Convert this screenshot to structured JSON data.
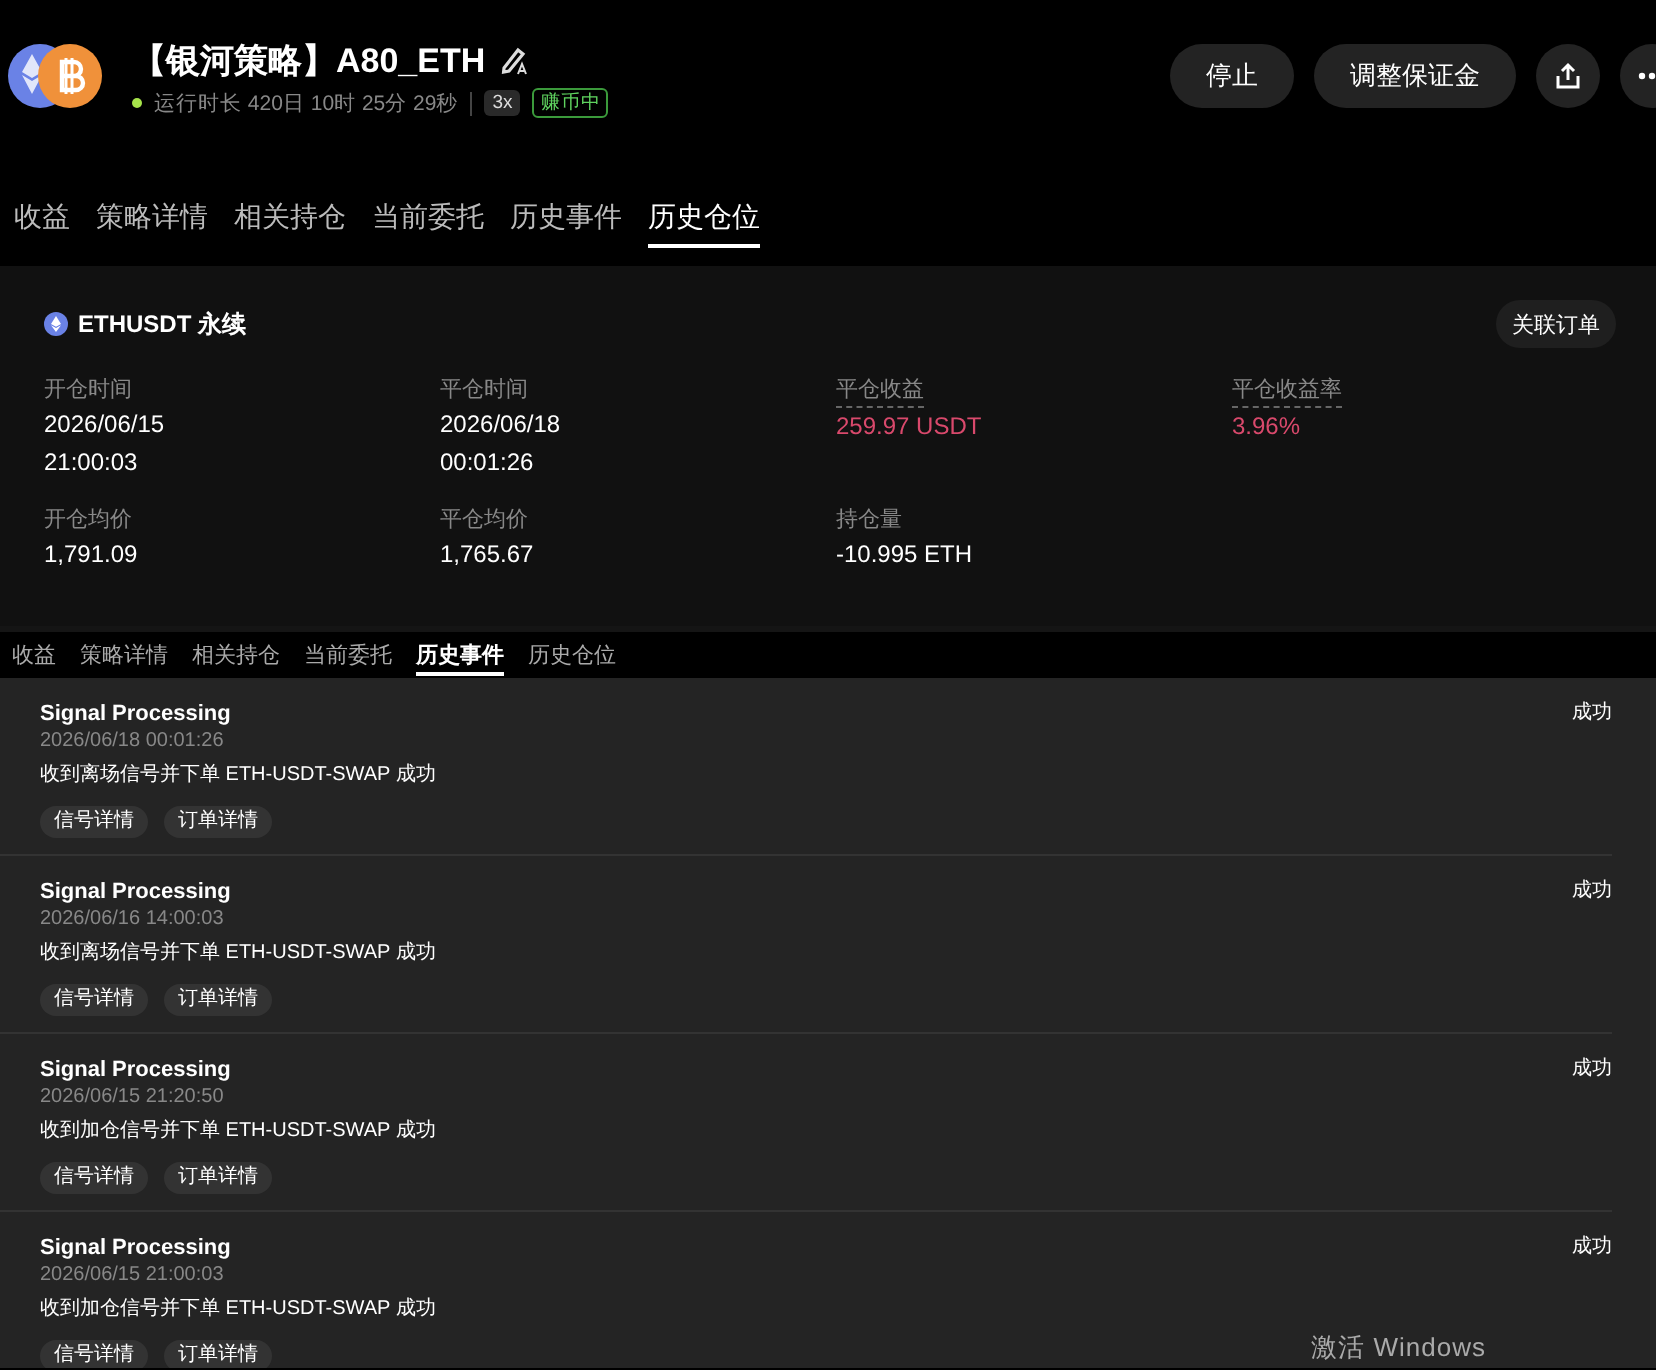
{
  "header": {
    "title": "【银河策略】A80_ETH",
    "runtime": "运行时长 420日 10时 25分 29秒",
    "leverage": "3x",
    "status": "赚币中",
    "running": true,
    "buttons": [
      "停止",
      "调整保证金"
    ]
  },
  "tabs": [
    {
      "label": "收益",
      "selected": false
    },
    {
      "label": "策略详情",
      "selected": false
    },
    {
      "label": "相关持仓",
      "selected": false
    },
    {
      "label": "当前委托",
      "selected": false
    },
    {
      "label": "历史事件",
      "selected": false
    },
    {
      "label": "历史仓位",
      "selected": true
    }
  ],
  "position": {
    "symbol": "ETHUSDT 永续",
    "link_button": "关联订单",
    "fields": [
      {
        "label": "开仓时间",
        "hint": false,
        "highlight": false,
        "values": [
          "2026/06/15",
          "21:00:03"
        ]
      },
      {
        "label": "平仓时间",
        "hint": false,
        "highlight": false,
        "values": [
          "2026/06/18",
          "00:01:26"
        ]
      },
      {
        "label": "平仓收益",
        "hint": true,
        "highlight": true,
        "values": [
          "259.97 USDT"
        ]
      },
      {
        "label": "平仓收益率",
        "hint": true,
        "highlight": true,
        "values": [
          "3.96%"
        ]
      },
      {
        "label": "开仓均价",
        "hint": false,
        "highlight": false,
        "values": [
          "1,791.09"
        ]
      },
      {
        "label": "平仓均价",
        "hint": false,
        "highlight": false,
        "values": [
          "1,765.67"
        ]
      },
      {
        "label": "持仓量",
        "hint": false,
        "highlight": false,
        "values": [
          "-10.995 ETH"
        ]
      }
    ]
  },
  "event_tabs": [
    {
      "label": "收益",
      "selected": false
    },
    {
      "label": "策略详情",
      "selected": false
    },
    {
      "label": "相关持仓",
      "selected": false
    },
    {
      "label": "当前委托",
      "selected": false
    },
    {
      "label": "历史事件",
      "selected": true
    },
    {
      "label": "历史仓位",
      "selected": false
    }
  ],
  "events": [
    {
      "title": "Signal Processing",
      "time": "2026/06/18 00:01:26",
      "message": "收到离场信号并下单 ETH-USDT-SWAP 成功",
      "status": "成功",
      "actions": [
        "信号详情",
        "订单详情"
      ]
    },
    {
      "title": "Signal Processing",
      "time": "2026/06/16 14:00:03",
      "message": "收到离场信号并下单 ETH-USDT-SWAP 成功",
      "status": "成功",
      "actions": [
        "信号详情",
        "订单详情"
      ]
    },
    {
      "title": "Signal Processing",
      "time": "2026/06/15 21:20:50",
      "message": "收到加仓信号并下单 ETH-USDT-SWAP 成功",
      "status": "成功",
      "actions": [
        "信号详情",
        "订单详情"
      ]
    },
    {
      "title": "Signal Processing",
      "time": "2026/06/15 21:00:03",
      "message": "收到加仓信号并下单 ETH-USDT-SWAP 成功",
      "status": "成功",
      "actions": [
        "信号详情",
        "订单详情"
      ]
    }
  ],
  "os_notice": "激活 Windows"
}
